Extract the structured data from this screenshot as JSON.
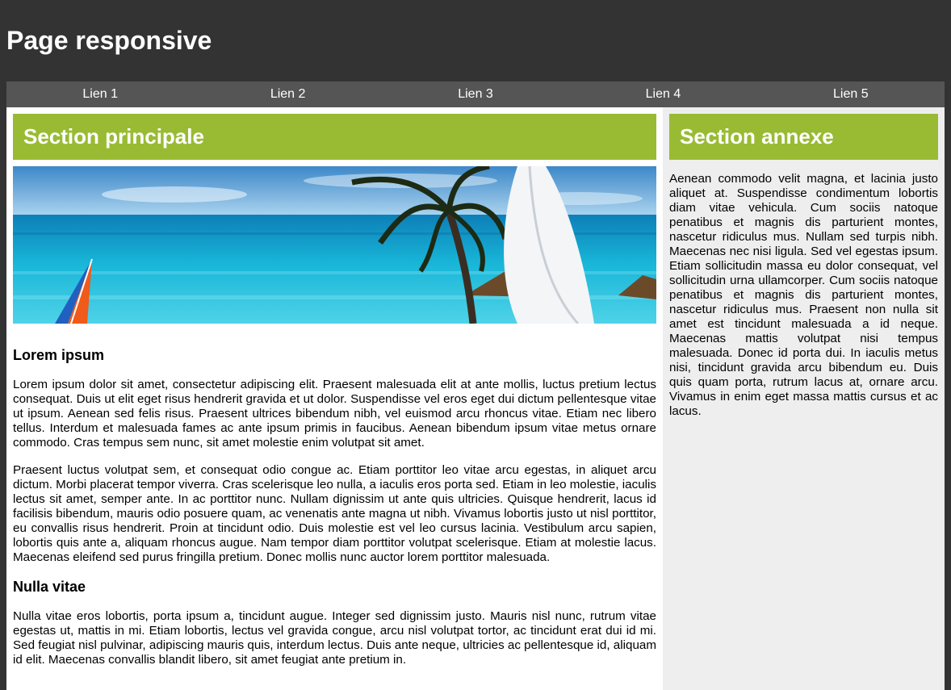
{
  "header": {
    "title": "Page responsive"
  },
  "nav": {
    "links": [
      "Lien 1",
      "Lien 2",
      "Lien 3",
      "Lien 4",
      "Lien 5"
    ]
  },
  "main": {
    "heading": "Section principale",
    "hero_image": "beach-palm-sailboat-image",
    "articles": [
      {
        "title": "Lorem ipsum",
        "paragraphs": [
          "Lorem ipsum dolor sit amet, consectetur adipiscing elit. Praesent malesuada elit at ante mollis, luctus pretium lectus consequat. Duis ut elit eget risus hendrerit gravida et ut dolor. Suspendisse vel eros eget dui dictum pellentesque vitae ut ipsum. Aenean sed felis risus. Praesent ultrices bibendum nibh, vel euismod arcu rhoncus vitae. Etiam nec libero tellus. Interdum et malesuada fames ac ante ipsum primis in faucibus. Aenean bibendum ipsum vitae metus ornare commodo. Cras tempus sem nunc, sit amet molestie enim volutpat sit amet.",
          "Praesent luctus volutpat sem, et consequat odio congue ac. Etiam porttitor leo vitae arcu egestas, in aliquet arcu dictum. Morbi placerat tempor viverra. Cras scelerisque leo nulla, a iaculis eros porta sed. Etiam in leo molestie, iaculis lectus sit amet, semper ante. In ac porttitor nunc. Nullam dignissim ut ante quis ultricies. Quisque hendrerit, lacus id facilisis bibendum, mauris odio posuere quam, ac venenatis ante magna ut nibh. Vivamus lobortis justo ut nisl porttitor, eu convallis risus hendrerit. Proin at tincidunt odio. Duis molestie est vel leo cursus lacinia. Vestibulum arcu sapien, lobortis quis ante a, aliquam rhoncus augue. Nam tempor diam porttitor volutpat scelerisque. Etiam at molestie lacus. Maecenas eleifend sed purus fringilla pretium. Donec mollis nunc auctor lorem porttitor malesuada."
        ]
      },
      {
        "title": "Nulla vitae",
        "paragraphs": [
          "Nulla vitae eros lobortis, porta ipsum a, tincidunt augue. Integer sed dignissim justo. Mauris nisl nunc, rutrum vitae egestas ut, mattis in mi. Etiam lobortis, lectus vel gravida congue, arcu nisl volutpat tortor, ac tincidunt erat dui id mi. Sed feugiat nisl pulvinar, adipiscing mauris quis, interdum lectus. Duis ante neque, ultricies ac pellentesque id, aliquam id elit. Maecenas convallis blandit libero, sit amet feugiat ante pretium in."
        ]
      }
    ]
  },
  "aside": {
    "heading": "Section annexe",
    "text": "Aenean commodo velit magna, et lacinia justo aliquet at. Suspendisse condimentum lobortis diam vitae vehicula. Cum sociis natoque penatibus et magnis dis parturient montes, nascetur ridiculus mus. Nullam sed turpis nibh. Maecenas nec nisi ligula. Sed vel egestas ipsum. Etiam sollicitudin massa eu dolor consequat, vel sollicitudin urna ullamcorper. Cum sociis natoque penatibus et magnis dis parturient montes, nascetur ridiculus mus. Praesent non nulla sit amet est tincidunt malesuada a id neque. Maecenas mattis volutpat nisi tempus malesuada. Donec id porta dui. In iaculis metus nisi, tincidunt gravida arcu bibendum eu. Duis quis quam porta, rutrum lacus at, ornare arcu. Vivamus in enim eget massa mattis cursus et ac lacus."
  },
  "colors": {
    "page_bg": "#333333",
    "nav_bg": "#555555",
    "accent_green": "#99bb33",
    "aside_bg": "#eeeeee"
  }
}
